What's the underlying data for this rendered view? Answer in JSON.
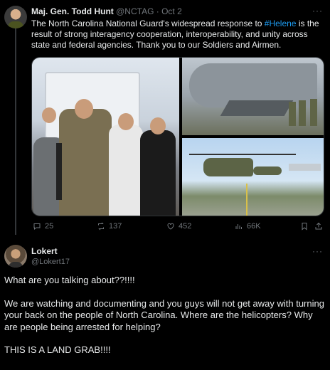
{
  "tweet": {
    "author": "Maj. Gen. Todd Hunt",
    "handle": "@NCTAG",
    "separator": "·",
    "date": "Oct 2",
    "text_pre": "The North Carolina National Guard's widespread response to ",
    "hashtag": "#Helene",
    "text_post": " is the result of strong interagency cooperation, interoperability, and unity across state and federal agencies.  Thank you to our Soldiers and Airmen.",
    "more": "···",
    "stats": {
      "replies": "25",
      "retweets": "137",
      "likes": "452",
      "views": "66K"
    }
  },
  "reply": {
    "author": "Lokert",
    "handle": "@Lokert17",
    "more": "···",
    "paragraphs": [
      "What are you talking about??!!!!",
      "We are watching and documenting and you guys will not get away with turning your back on the people of North Carolina. Where are the helicopters?  Why are people being arrested for helping?",
      "THIS IS A LAND GRAB!!!!"
    ]
  },
  "colors": {
    "background": "#000000",
    "text": "#e7e9ea",
    "muted": "#71767b",
    "link": "#1d9bf0"
  },
  "icons": [
    "reply-icon",
    "retweet-icon",
    "like-icon",
    "views-icon",
    "bookmark-icon",
    "share-icon"
  ]
}
